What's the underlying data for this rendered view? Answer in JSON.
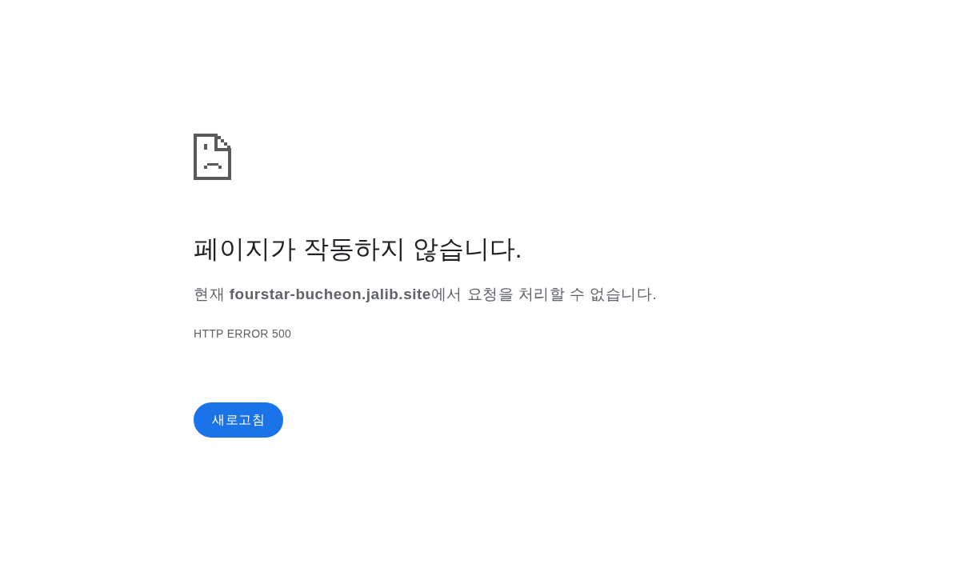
{
  "error_page": {
    "heading": "페이지가 작동하지 않습니다.",
    "message": "현재 **fourstar-bucheon.jalib.site**에서 요청을 처리할 수 없습니다.",
    "error_code": "HTTP ERROR 500",
    "buttons": [
      {
        "label": "새로고침"
      }
    ]
  }
}
